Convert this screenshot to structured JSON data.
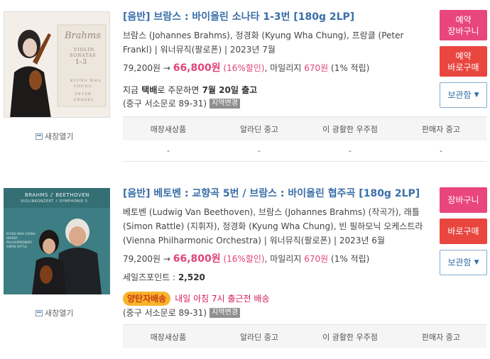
{
  "items": [
    {
      "cover_text": {
        "script": "Brahms",
        "line1": "VIOLIN",
        "line2": "SONATAS",
        "nums": "1–3",
        "artist1": "KYUNG WHA",
        "artist2": "CHUNG",
        "artist3": "PETER",
        "artist4": "FRANKL"
      },
      "new_window": "새창열기",
      "title": "[음반] 브람스 : 바이올린 소나타 1-3번 [180g 2LP]",
      "meta": "브람스 (Johannes Brahms), 정경화 (Kyung Wha Chung), 프랑클 (Peter Frankl) | 워너뮤직(팔로폰) | 2023년 7월",
      "price": {
        "list": "79,200원",
        "arrow": "→",
        "sale": "66,800원",
        "discount": "(16%할인)",
        "mileage_label": ", 마일리지",
        "mileage": "670원",
        "mileage_rate": "(1% 적립)"
      },
      "delivery": {
        "prefix": "지금",
        "method": "택배",
        "mid": "로 주문하면",
        "date": "7월 20일 출고"
      },
      "address": "(중구 서소문로 89-31)",
      "region_tag": "지역변경",
      "buttons": {
        "cart": [
          "예약",
          "장바구니"
        ],
        "buy": [
          "예약",
          "바로구매"
        ],
        "keep": "보관함"
      },
      "store_headers": [
        "매장새상품",
        "알라딘 중고",
        "이 광활한 우주점",
        "판매자 중고"
      ],
      "store_values": [
        "-",
        "-",
        "-",
        "-"
      ]
    },
    {
      "cover_text": {
        "top": "BRAHMS ♪ BEETHOVEN",
        "sub": "VIOLINKONZERT ♪ SYMPHONIE 5",
        "side1": "KYUNG WHA CHUNG",
        "side2": "WIENER",
        "side3": "PHILHARMONIKER",
        "side4": "SIMON RATTLE"
      },
      "new_window": "새창열기",
      "title": "[음반] 베토벤 : 교향곡 5번 / 브람스 : 바이올린 협주곡 [180g 2LP]",
      "meta": "베토벤 (Ludwig Van Beethoven), 브람스 (Johannes Brahms) (작곡가), 래틀 (Simon Rattle) (지휘자), 정경화 (Kyung Wha Chung), 빈 필하모닉 오케스트라 (Vienna Philharmonic Orchestra) | 워너뮤직(팔로폰) | 2023년 6월",
      "price": {
        "list": "79,200원",
        "arrow": "→",
        "sale": "66,800원",
        "discount": "(16%할인)",
        "mileage_label": ", 마일리지",
        "mileage": "670원",
        "mileage_rate": "(1% 적립)"
      },
      "sales_point": {
        "label": "세일즈포인트 :",
        "value": "2,520"
      },
      "yangtan": {
        "badge": "양탄자배송",
        "text": "내일 아침 7시 출근전 배송"
      },
      "address": "(중구 서소문로 89-31)",
      "region_tag": "지역변경",
      "buttons": {
        "cart": "장바구니",
        "buy": "바로구매",
        "keep": "보관함"
      },
      "store_headers": [
        "매장새상품",
        "알라딘 중고",
        "이 광활한 우주점",
        "판매자 중고"
      ]
    }
  ],
  "colors": {
    "title_blue": "#3a6fa8",
    "sale_pink": "#e0447a",
    "cart_pink": "#e8467c",
    "buy_red": "#e8463f",
    "badge_yellow": "#f8b42b"
  }
}
